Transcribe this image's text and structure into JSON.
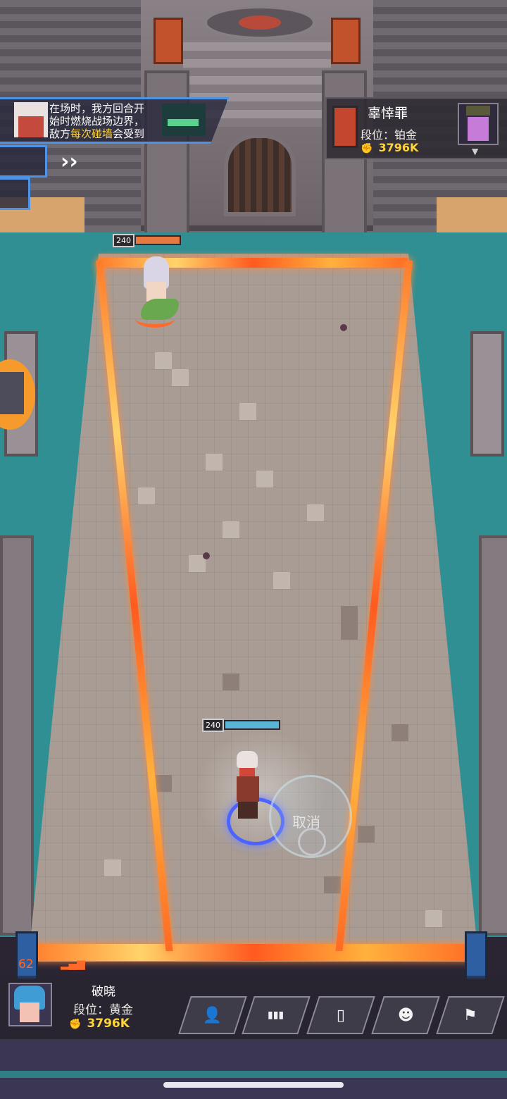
{
  "info_panel": {
    "line1": "在场时，我方回合开",
    "line2": "始时燃烧战场边界，",
    "line3_prefix": "敌方",
    "line3_highlight": "每次碰墙",
    "line3_suffix": "会受到"
  },
  "opponent": {
    "name": "辜悻罪",
    "rank": "段位：铂金",
    "power": "3796K",
    "power_icon": "fist-icon"
  },
  "player": {
    "name": "破晓",
    "rank": "段位：黄金",
    "power": "3796K",
    "power_icon": "fist-icon",
    "ping": "62"
  },
  "units": {
    "enemy_hp": "240",
    "player_hp": "240"
  },
  "skill": {
    "cancel_label": "取消"
  },
  "action_buttons": [
    {
      "name": "player-list-button",
      "icon": "user-list-icon",
      "glyph": "👤"
    },
    {
      "name": "stats-button",
      "icon": "bar-chart-icon",
      "glyph": "▮▮▮"
    },
    {
      "name": "item-button",
      "icon": "bottle-icon",
      "glyph": "▯"
    },
    {
      "name": "emote-button",
      "icon": "smile-icon",
      "glyph": "☻"
    },
    {
      "name": "surrender-button",
      "icon": "flag-icon",
      "glyph": "⚑"
    }
  ],
  "colors": {
    "highlight": "#ffd43b",
    "panel_border": "#4f93e6",
    "fire": "#ff7b2a",
    "player_ring": "#4d63ff"
  }
}
